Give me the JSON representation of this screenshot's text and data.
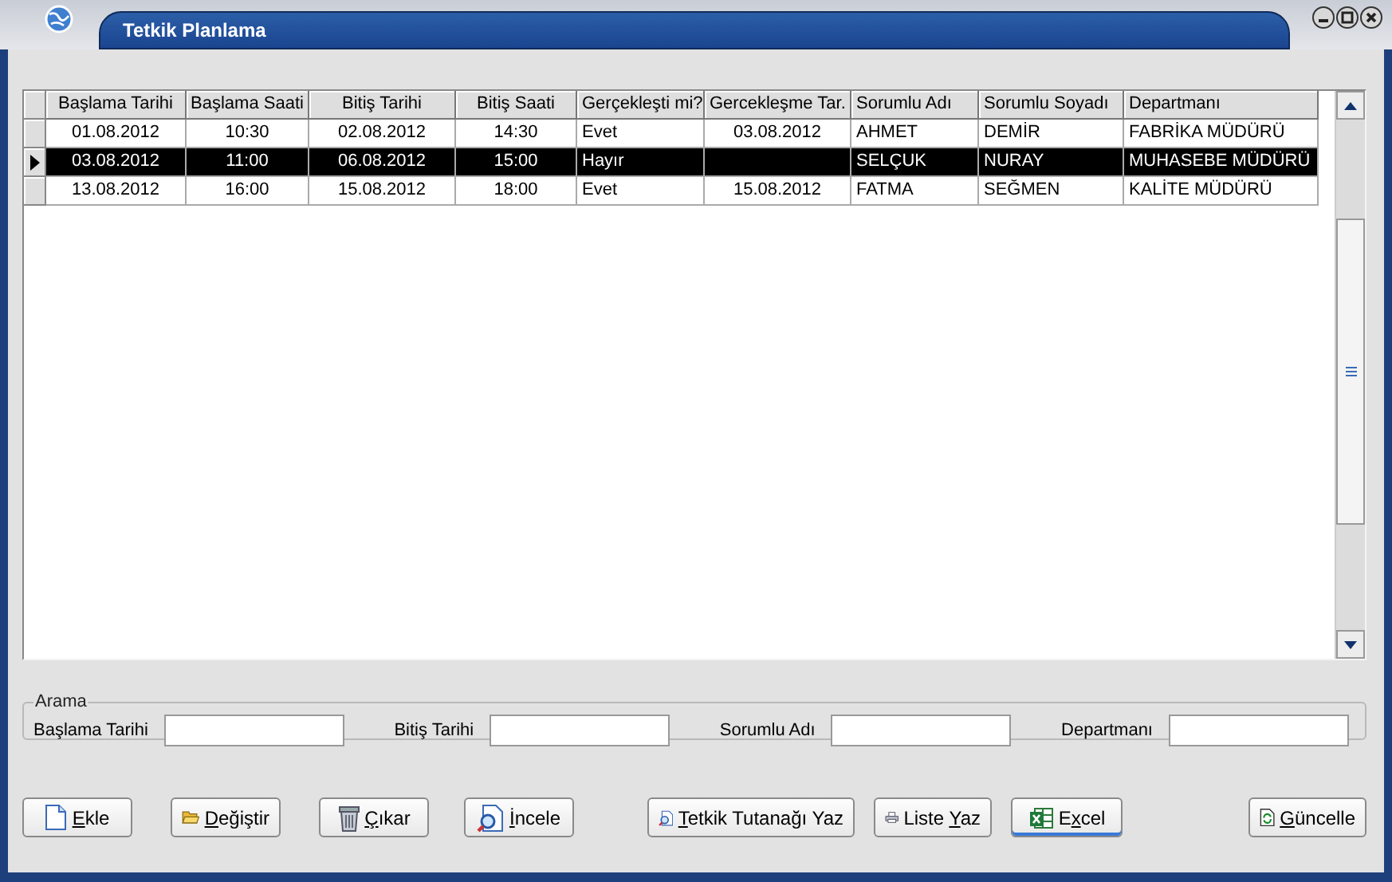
{
  "window": {
    "title": "Tetkik Planlama"
  },
  "table": {
    "columns": [
      "Başlama Tarihi",
      "Başlama Saati",
      "Bitiş Tarihi",
      "Bitiş Saati",
      "Gerçekleşti mi?",
      "Gercekleşme Tar.",
      "Sorumlu Adı",
      "Sorumlu Soyadı",
      "Departmanı"
    ],
    "rows": [
      {
        "selected": false,
        "cells": [
          "01.08.2012",
          "10:30",
          "02.08.2012",
          "14:30",
          "Evet",
          "03.08.2012",
          "AHMET",
          "DEMİR",
          "FABRİKA MÜDÜRÜ"
        ]
      },
      {
        "selected": true,
        "cells": [
          "03.08.2012",
          "11:00",
          "06.08.2012",
          "15:00",
          "Hayır",
          "",
          "SELÇUK",
          "NURAY",
          "MUHASEBE MÜDÜRÜ"
        ]
      },
      {
        "selected": false,
        "cells": [
          "13.08.2012",
          "16:00",
          "15.08.2012",
          "18:00",
          "Evet",
          "15.08.2012",
          "FATMA",
          "SEĞMEN",
          "KALİTE MÜDÜRÜ"
        ]
      }
    ]
  },
  "search": {
    "title": "Arama",
    "fields": [
      {
        "label": "Başlama Tarihi"
      },
      {
        "label": "Bitiş Tarihi"
      },
      {
        "label": "Sorumlu Adı"
      },
      {
        "label": "Departmanı"
      }
    ]
  },
  "buttons": [
    {
      "kind": "new",
      "mnemonic": "E",
      "rest": "kle",
      "focused": false
    },
    {
      "kind": "edit",
      "mnemonic": "D",
      "rest": "eğiştir",
      "focused": false
    },
    {
      "kind": "delete",
      "mnemonic": "Ç",
      "rest": "ıkar",
      "focused": false
    },
    {
      "kind": "view",
      "mnemonic": "İ",
      "rest": "ncele",
      "focused": false
    },
    {
      "kind": "report",
      "mnemonic": "T",
      "rest": "etkik Tutanağı Yaz",
      "focused": false
    },
    {
      "kind": "print",
      "pre": "Liste ",
      "mnemonic": "Y",
      "rest": "az",
      "focused": false
    },
    {
      "kind": "excel",
      "pre": "E",
      "mnemonic": "x",
      "rest": "cel",
      "focused": true
    },
    {
      "kind": "refresh",
      "mnemonic": "G",
      "rest": "üncelle",
      "focused": false
    }
  ]
}
